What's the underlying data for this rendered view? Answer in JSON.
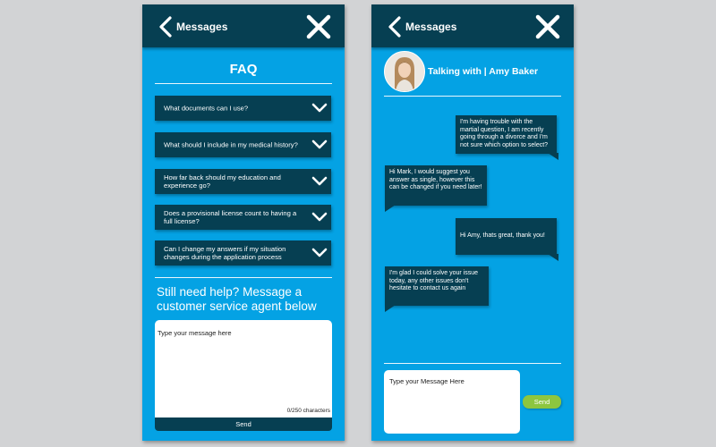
{
  "faq_screen": {
    "header": {
      "back_label": "Messages",
      "back_icon": "chevron-left-icon",
      "close_icon": "close-icon"
    },
    "title": "FAQ",
    "questions": [
      "What documents can I use?",
      "What should I include in my medical history?",
      "How far back should my education and experience go?",
      "Does a provisional license count to having a full license?",
      "Can I change my answers if my situation changes during the application process"
    ],
    "help_text": "Still need help? Message a customer service agent below",
    "message_placeholder": "Type your message here",
    "char_count": "0/250 characters",
    "send_label": "Send"
  },
  "chat_screen": {
    "header": {
      "back_label": "Messages",
      "back_icon": "chevron-left-icon",
      "close_icon": "close-icon"
    },
    "heading": "Talking with | Amy Baker",
    "messages": [
      {
        "from": "user",
        "text": "I'm having trouble with the martial question, I am recently going through a divorce and I'm not sure which option to select?"
      },
      {
        "from": "agent",
        "text": "Hi Mark, I would suggest you answer as single, however this can be changed if you need later!"
      },
      {
        "from": "user",
        "text": "Hi Amy, thats great, thank you!"
      },
      {
        "from": "agent",
        "text": "I'm glad I could solve your issue today, any other issues don't hesitate to contact us again"
      }
    ],
    "input_placeholder": "Type your Message Here",
    "send_label": "Send"
  },
  "colors": {
    "background": "#d2d3d5",
    "screen": "#04a2e4",
    "dark": "#063f52",
    "send_green": "#8dc63f"
  }
}
